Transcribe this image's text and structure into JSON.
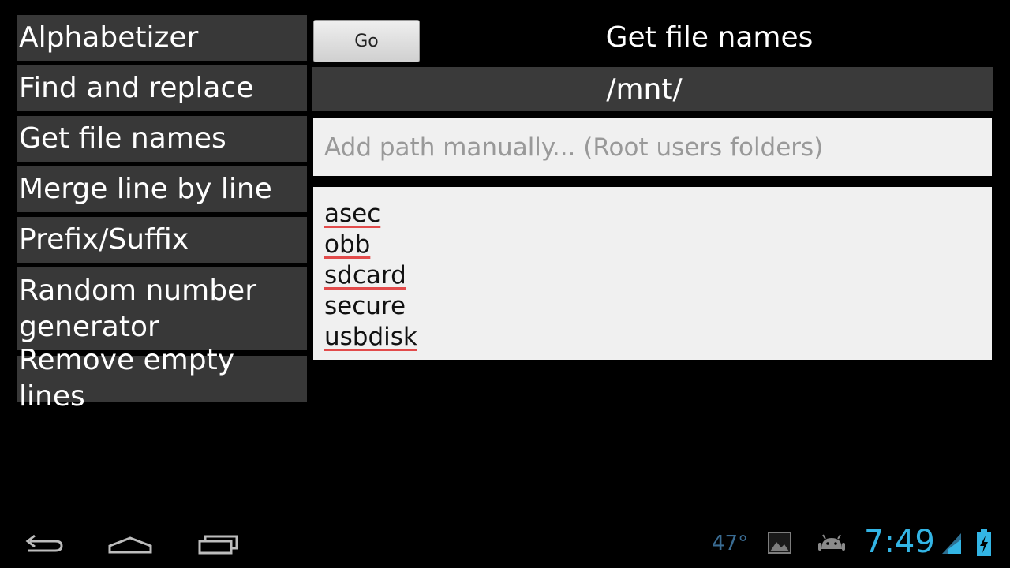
{
  "menu": {
    "items": [
      {
        "label": "Alphabetizer"
      },
      {
        "label": "Find and replace"
      },
      {
        "label": "Get file names"
      },
      {
        "label": "Merge line by line"
      },
      {
        "label": "Prefix/Suffix"
      },
      {
        "label": "Random number\ngenerator"
      },
      {
        "label": "Remove empty lines"
      }
    ]
  },
  "main": {
    "go_label": "Go",
    "title": "Get file names",
    "current_path": "/mnt/",
    "path_input": {
      "placeholder": "Add path manually... (Root users folders)",
      "value": ""
    },
    "files": [
      "asec",
      "obb",
      "sdcard",
      "secure",
      "usbdisk"
    ]
  },
  "status_bar": {
    "temperature": "47°",
    "time": "7:49",
    "icons": [
      "back-icon",
      "home-icon",
      "recent-apps-icon",
      "gallery-icon",
      "android-icon",
      "signal-icon",
      "battery-charging-icon"
    ],
    "accent_color": "#33b5e5"
  }
}
